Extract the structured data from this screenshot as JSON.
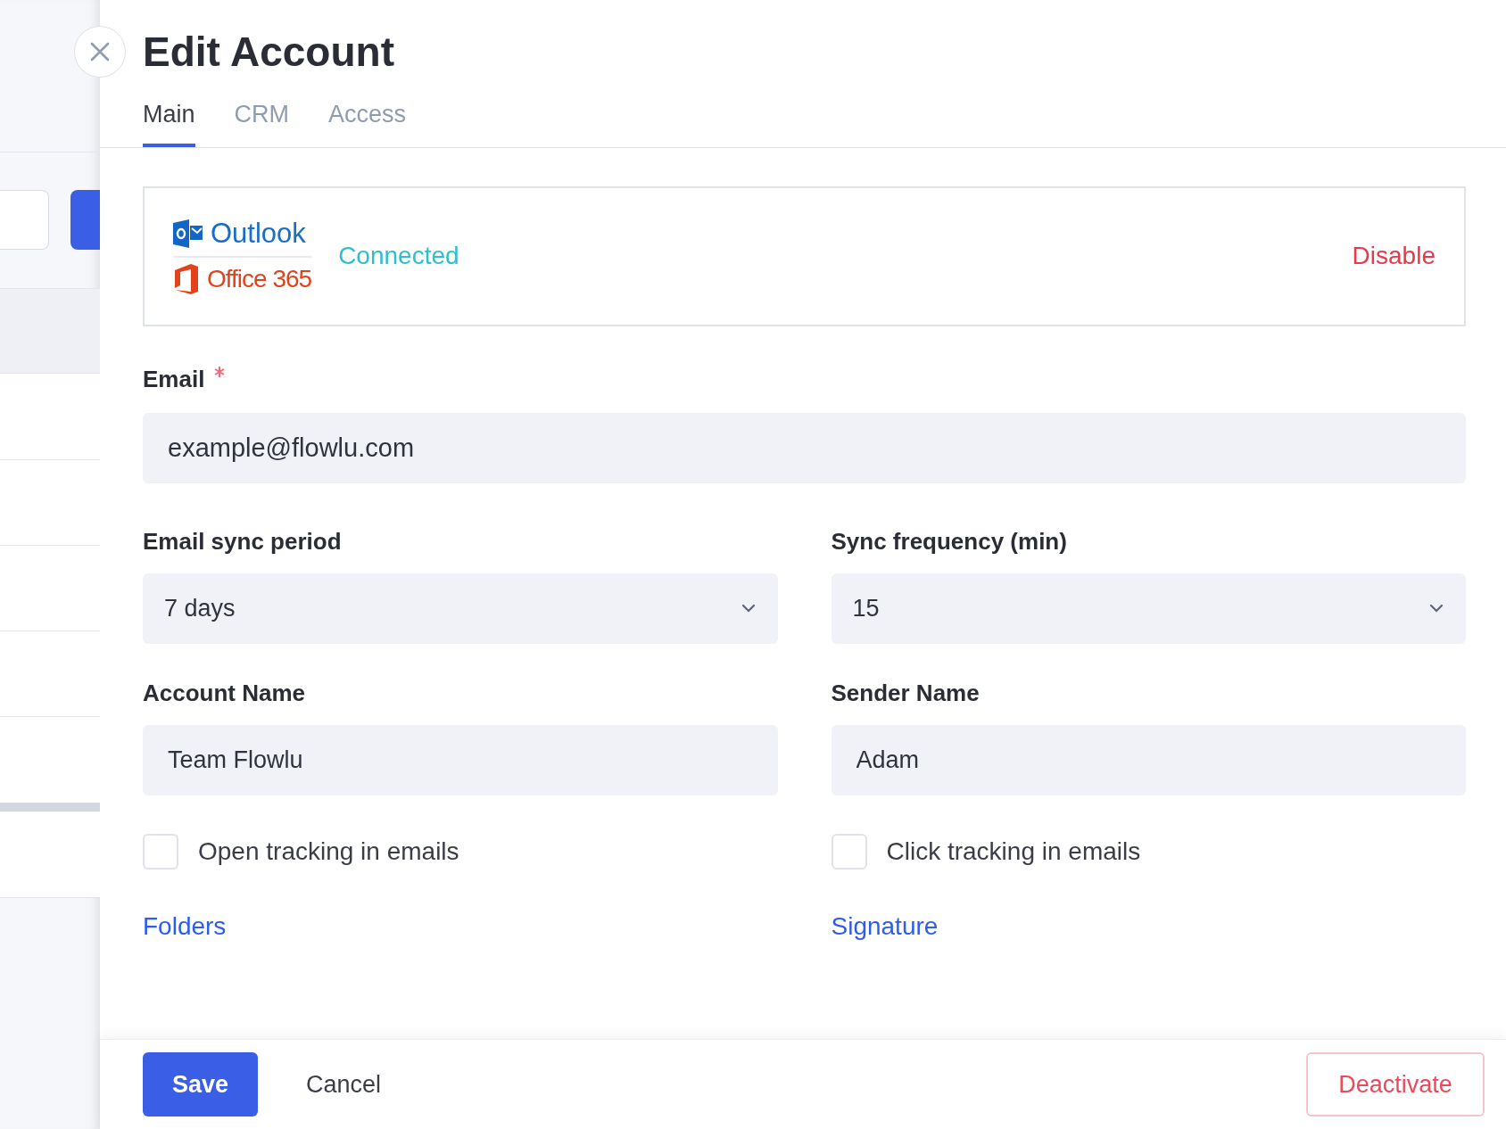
{
  "title": "Edit Account",
  "tabs": [
    {
      "label": "Main",
      "selected": true
    },
    {
      "label": "CRM",
      "selected": false
    },
    {
      "label": "Access",
      "selected": false
    }
  ],
  "connection": {
    "logo_top": "Outlook",
    "logo_bottom": "Office 365",
    "status": "Connected",
    "action": "Disable"
  },
  "email": {
    "label": "Email",
    "required": true,
    "value": "example@flowlu.com"
  },
  "fields": [
    {
      "kind": "select",
      "label": "Email sync period",
      "value": "7 days"
    },
    {
      "kind": "select",
      "label": "Sync frequency (min)",
      "value": "15"
    },
    {
      "kind": "text",
      "label": "Account Name",
      "value": "Team Flowlu"
    },
    {
      "kind": "text",
      "label": "Sender Name",
      "value": "Adam"
    }
  ],
  "checkboxes": [
    {
      "label": "Open tracking in emails",
      "checked": false
    },
    {
      "label": "Click tracking in emails",
      "checked": false
    }
  ],
  "links": [
    "Folders",
    "Signature"
  ],
  "footer": {
    "save": "Save",
    "cancel": "Cancel",
    "deactivate": "Deactivate"
  }
}
